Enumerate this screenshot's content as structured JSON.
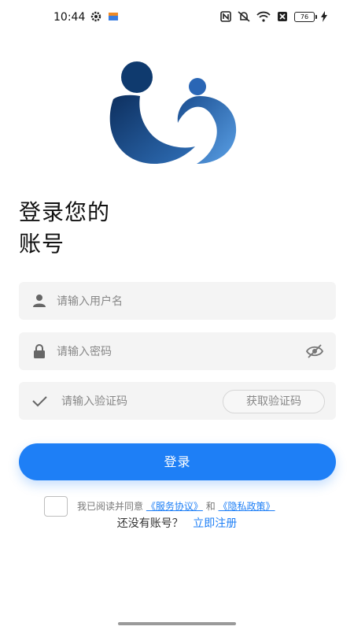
{
  "status_bar": {
    "time": "10:44",
    "battery": "76",
    "icons": [
      "settings-gear-icon",
      "app-notification-icon",
      "nfc-icon",
      "mute-icon",
      "wifi-icon",
      "no-sim-icon",
      "battery-icon",
      "charging-icon"
    ]
  },
  "logo": {
    "name": "brand-logo"
  },
  "title": {
    "line1": "登录您的",
    "line2": "账号"
  },
  "form": {
    "username_placeholder": "请输入用户名",
    "password_placeholder": "请输入密码",
    "code_placeholder": "请输入验证码",
    "get_code_label": "获取验证码",
    "login_label": "登录"
  },
  "agreement": {
    "prefix": "我已阅读并同意",
    "service_link": "《服务协议》",
    "and": "和",
    "privacy_link": "《隐私政策》"
  },
  "register": {
    "question": "还没有账号？",
    "link": "立即注册"
  },
  "colors": {
    "primary": "#1e7ff6",
    "field_bg": "#f4f4f4",
    "logo_dark": "#0f3a6e",
    "logo_light": "#4a8fd6"
  }
}
